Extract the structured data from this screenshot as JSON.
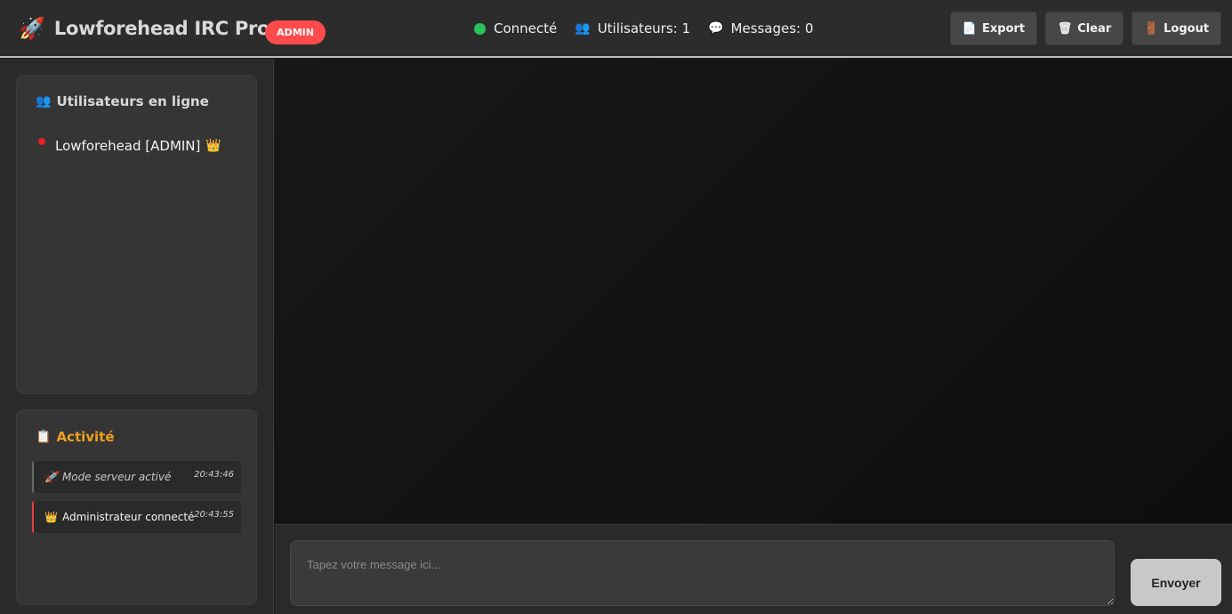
{
  "header": {
    "rocket_icon": "🚀",
    "title": "Lowforehead IRC Pro",
    "role_badge": "ADMIN",
    "status": {
      "connection": "Connecté",
      "users_icon": "👥",
      "users": "Utilisateurs: 1",
      "messages_icon": "💬",
      "messages": "Messages: 0"
    },
    "buttons": {
      "export_icon": "📄",
      "export": "Export",
      "clear_icon": "🗑",
      "clear": "Clear",
      "logout_icon": "🚪",
      "logout": "Logout"
    }
  },
  "sidebar": {
    "users_panel": {
      "icon": "👥",
      "title": "Utilisateurs en ligne",
      "users": [
        {
          "name": "Lowforehead [ADMIN]",
          "badge_icon": "👑",
          "status_color": "#e82020"
        }
      ]
    },
    "activity_panel": {
      "icon": "📋",
      "title": "Activité",
      "items": [
        {
          "icon": "🚀",
          "text": "Mode serveur activé",
          "time": "20:43:46"
        },
        {
          "icon": "👑",
          "text": "Administrateur connecté",
          "time": "20:43:55"
        }
      ]
    }
  },
  "composer": {
    "placeholder": "Tapez votre message ici...",
    "value": "",
    "send_label": "Envoyer"
  },
  "colors": {
    "accent_red": "#ff4b4b",
    "online_green": "#27c35a",
    "activity_orange": "#f0a020"
  }
}
